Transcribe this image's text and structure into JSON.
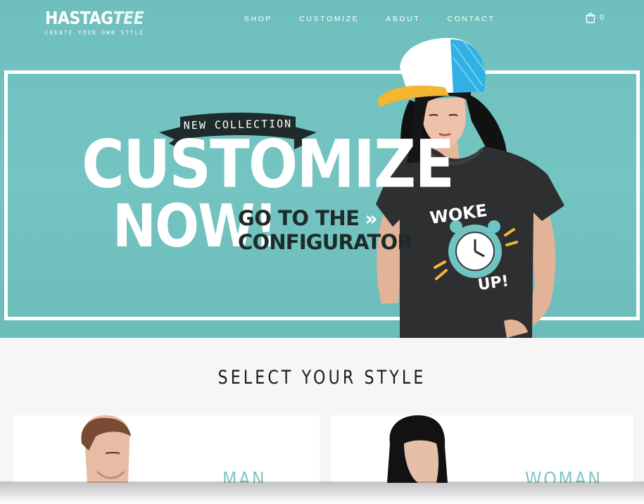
{
  "brand": {
    "name_part1": "HASTAG",
    "name_part2": "TEE",
    "tagline": "CREATE YOUR OWN STYLE"
  },
  "nav": {
    "items": [
      {
        "label": "SHOP"
      },
      {
        "label": "CUSTOMIZE"
      },
      {
        "label": "ABOUT"
      },
      {
        "label": "CONTACT"
      }
    ],
    "cart_count": "0",
    "cart_icon": "shopping-bag-icon"
  },
  "hero": {
    "banner_label": "NEW COLLECTION",
    "headline_line1": "CUSTOMIZE",
    "headline_line2": "NOW!",
    "cta_line1": "GO TO THE",
    "cta_arrow": "»",
    "cta_line2": "CONFIGURATOR",
    "shirt_print_line1": "WOKE",
    "shirt_print_line2": "UP!"
  },
  "styles": {
    "title": "SELECT YOUR STYLE",
    "cards": [
      {
        "label": "MAN"
      },
      {
        "label": "WOMAN"
      }
    ]
  },
  "colors": {
    "hero_bg": "#6ebfbd",
    "accent": "#7ec8c6",
    "dark_text": "#1f2a2a",
    "section_bg": "#f6f6f6"
  }
}
